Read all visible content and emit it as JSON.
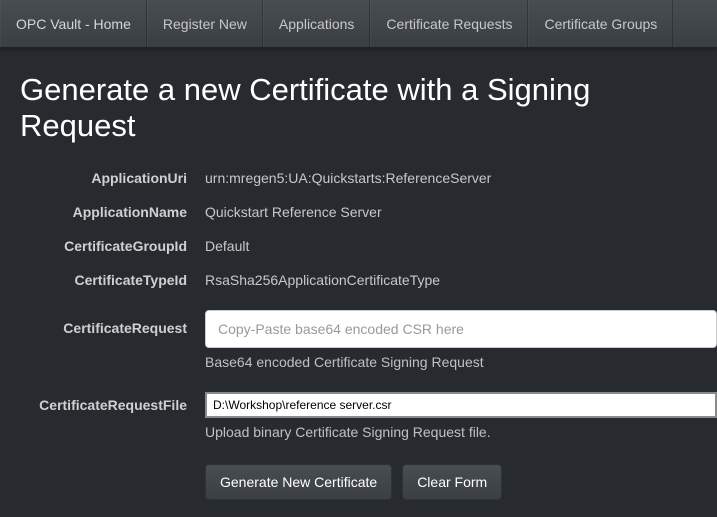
{
  "nav": {
    "brand": "OPC Vault - Home",
    "items": [
      "Register New",
      "Applications",
      "Certificate Requests",
      "Certificate Groups"
    ]
  },
  "page": {
    "title": "Generate a new Certificate with a Signing Request"
  },
  "form": {
    "applicationUri": {
      "label": "ApplicationUri",
      "value": "urn:mregen5:UA:Quickstarts:ReferenceServer"
    },
    "applicationName": {
      "label": "ApplicationName",
      "value": "Quickstart Reference Server"
    },
    "certificateGroupId": {
      "label": "CertificateGroupId",
      "value": "Default"
    },
    "certificateTypeId": {
      "label": "CertificateTypeId",
      "value": "RsaSha256ApplicationCertificateType"
    },
    "certificateRequest": {
      "label": "CertificateRequest",
      "placeholder": "Copy-Paste base64 encoded CSR here",
      "help": "Base64 encoded Certificate Signing Request"
    },
    "certificateRequestFile": {
      "label": "CertificateRequestFile",
      "value": "D:\\Workshop\\reference server.csr",
      "help": "Upload binary Certificate Signing Request file."
    },
    "buttons": {
      "generate": "Generate New Certificate",
      "clear": "Clear Form"
    }
  }
}
